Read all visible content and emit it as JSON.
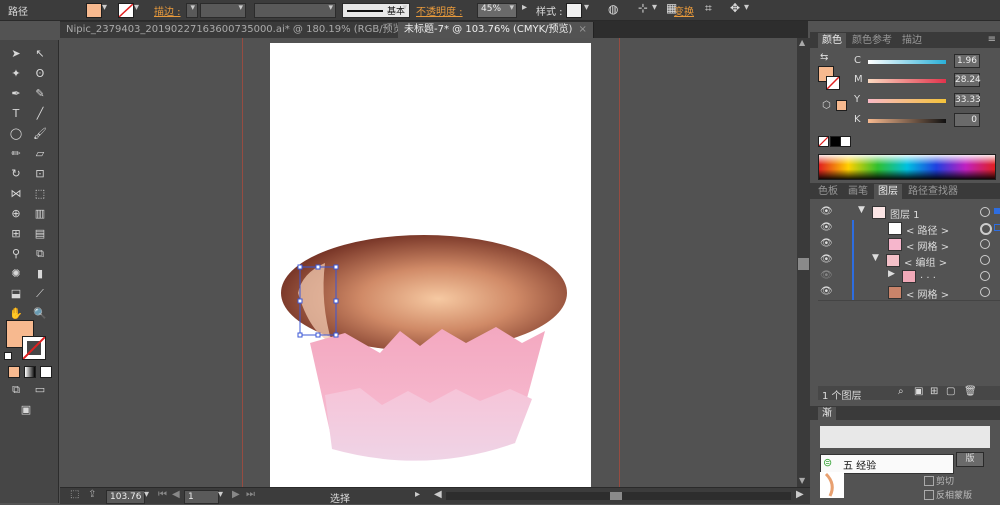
{
  "control_bar": {
    "object_type": "路径",
    "fill_color": "#f7b98f",
    "stroke_label": "描边 :",
    "brush_label": "基本",
    "opacity_label": "不透明度 :",
    "opacity_value": "45%",
    "style_label": "样式 :",
    "transform_label": "变换"
  },
  "tabs": [
    {
      "label": "Nipic_2379403_20190227163600735000.ai* @ 180.19% (RGB/预览)",
      "close": "×"
    },
    {
      "label": "未标题-7* @ 103.76% (CMYK/预览)",
      "close": "×"
    }
  ],
  "status": {
    "zoom": "103.76",
    "page": "1",
    "tool_name": "选择"
  },
  "color_panel": {
    "tabs": [
      "颜色",
      "颜色参考",
      "描边"
    ],
    "fill_color": "#f7b98f",
    "channels": [
      {
        "name": "C",
        "value": "1.96",
        "pct": 0.02
      },
      {
        "name": "M",
        "value": "28.24",
        "pct": 0.28
      },
      {
        "name": "Y",
        "value": "33.33",
        "pct": 0.33
      },
      {
        "name": "K",
        "value": "0",
        "pct": 0.0
      }
    ]
  },
  "layers_panel": {
    "tabs": [
      "色板",
      "画笔",
      "图层",
      "路径查找器"
    ],
    "rows": [
      {
        "name": "图层 1",
        "indent": 0,
        "expanded": true
      },
      {
        "name": "< 路径 >",
        "indent": 2
      },
      {
        "name": "< 网格 >",
        "indent": 2
      },
      {
        "name": "< 编组 >",
        "indent": 1,
        "expanded": true
      },
      {
        "name": ". . .",
        "indent": 2
      },
      {
        "name": "< 网格 >",
        "indent": 1
      }
    ],
    "footer": "1 个图层"
  },
  "bottom_panel": {
    "tab": "渐",
    "item_a": "剪切",
    "item_b": "反相蒙版",
    "button": "版"
  },
  "watermark": "五  经验"
}
